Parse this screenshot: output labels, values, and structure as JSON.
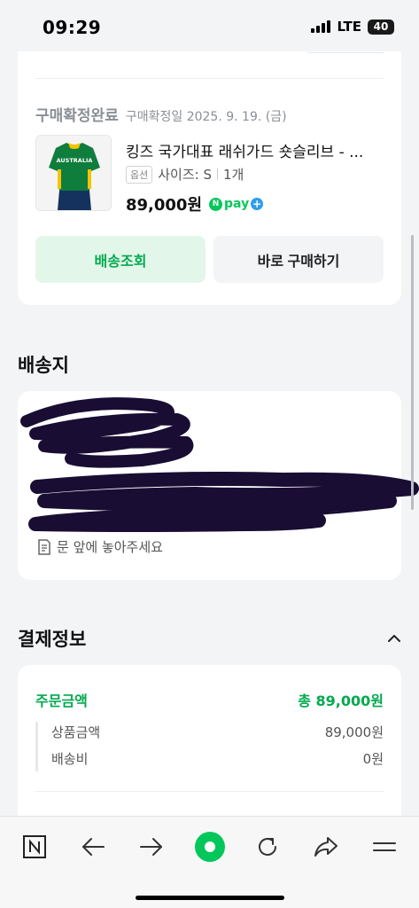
{
  "status_bar": {
    "time": "09:29",
    "network": "LTE",
    "battery": "40"
  },
  "order": {
    "top_cut_text": "",
    "confirm_status": "구매확정완료",
    "confirm_date": "구매확정일 2025. 9. 19. (금)",
    "product_name": "킹즈 국가대표 래쉬가드 숏슬리브 - ...",
    "thumb_text": "AUSTRALIA",
    "option_badge": "옵션",
    "option_text": "사이즈: S",
    "quantity": "1개",
    "price": "89,000원",
    "npay_label": "pay",
    "npay_n": "N",
    "buttons": {
      "track": "배송조회",
      "buy_again": "바로 구매하기"
    }
  },
  "address": {
    "title": "배송지",
    "memo": "문 앞에 놓아주세요"
  },
  "payment": {
    "title": "결제정보",
    "order_amount_label": "주문금액",
    "order_amount_total": "총 89,000원",
    "items": [
      {
        "label": "상품금액",
        "value": "89,000원"
      },
      {
        "label": "배송비",
        "value": "0원"
      }
    ]
  },
  "colors": {
    "accent_green": "#03a94f",
    "naver_green": "#03c75a",
    "redaction": "#1a0d33"
  },
  "toolbar_icons": [
    "naver-home-icon",
    "back-icon",
    "forward-icon",
    "green-dot-icon",
    "refresh-icon",
    "share-icon",
    "menu-icon"
  ]
}
